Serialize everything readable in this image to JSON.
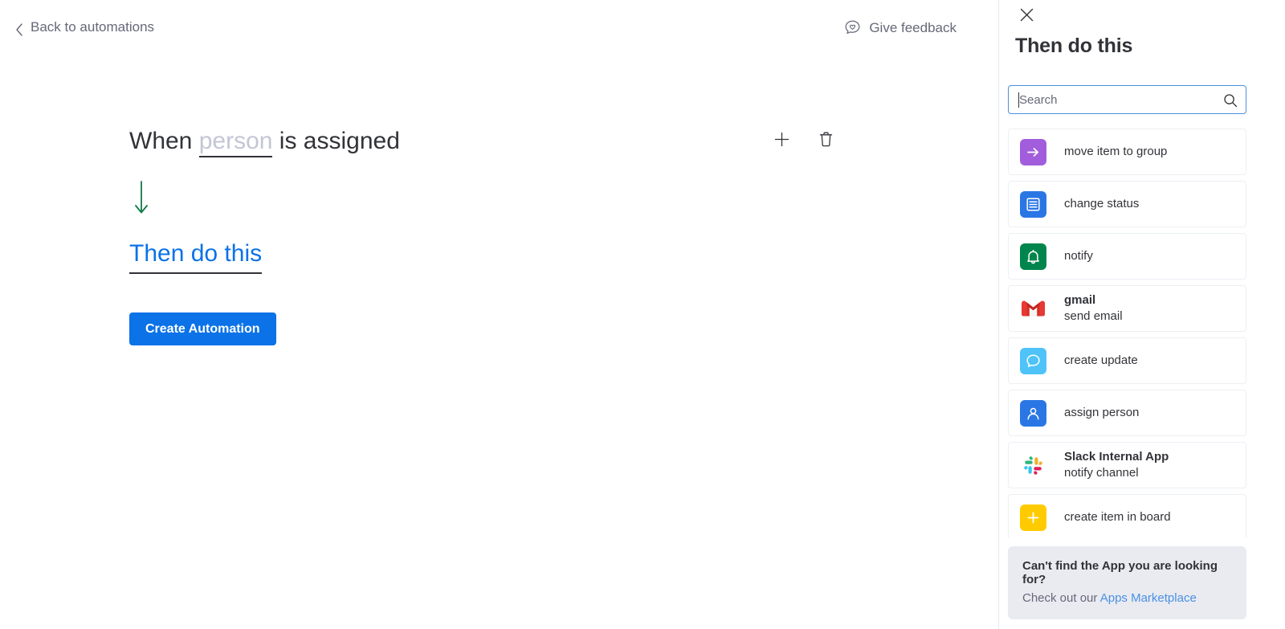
{
  "header": {
    "back_label": "Back to automations",
    "back_icon": "chevron-left-icon",
    "feedback_label": "Give feedback",
    "feedback_icon": "speech-bubble-heart-icon"
  },
  "recipe": {
    "trigger_prefix": "When",
    "trigger_token": "person",
    "trigger_suffix": "is assigned",
    "add_icon": "plus-icon",
    "delete_icon": "trash-icon",
    "flow_arrow_icon": "arrow-down-icon",
    "action_placeholder": "Then do this",
    "create_label": "Create Automation"
  },
  "panel": {
    "close_icon": "close-icon",
    "title": "Then do this",
    "search": {
      "placeholder": "Search",
      "value": "",
      "icon": "search-icon"
    },
    "actions": [
      {
        "icon": "arrow-right-icon",
        "icon_bg": "#a25ddc",
        "app": "",
        "label": "move item to group"
      },
      {
        "icon": "status-list-icon",
        "icon_bg": "#2b76e5",
        "app": "",
        "label": "change status"
      },
      {
        "icon": "bell-icon",
        "icon_bg": "#00854d",
        "app": "",
        "label": "notify"
      },
      {
        "icon": "gmail-icon",
        "icon_bg": "transparent",
        "app": "gmail",
        "label": "send email"
      },
      {
        "icon": "chat-bubble-icon",
        "icon_bg": "#4fc3f7",
        "app": "",
        "label": "create update"
      },
      {
        "icon": "person-icon",
        "icon_bg": "#2b76e5",
        "app": "",
        "label": "assign person"
      },
      {
        "icon": "slack-icon",
        "icon_bg": "transparent",
        "app": "Slack Internal App",
        "label": "notify channel"
      },
      {
        "icon": "plus-square-icon",
        "icon_bg": "#ffcb00",
        "app": "",
        "label": "create item in board"
      }
    ],
    "footer": {
      "title": "Can't find the App you are looking for?",
      "text_prefix": "Check out our ",
      "link_label": "Apps Marketplace"
    }
  },
  "colors": {
    "accent_blue": "#0b72e7",
    "link_blue": "#4a90e2",
    "text_dark": "#323338",
    "text_muted": "#676879",
    "token_gray": "#c3c6d4",
    "arrow_green": "#0f7a45",
    "footer_bg": "#e9ebf1"
  }
}
